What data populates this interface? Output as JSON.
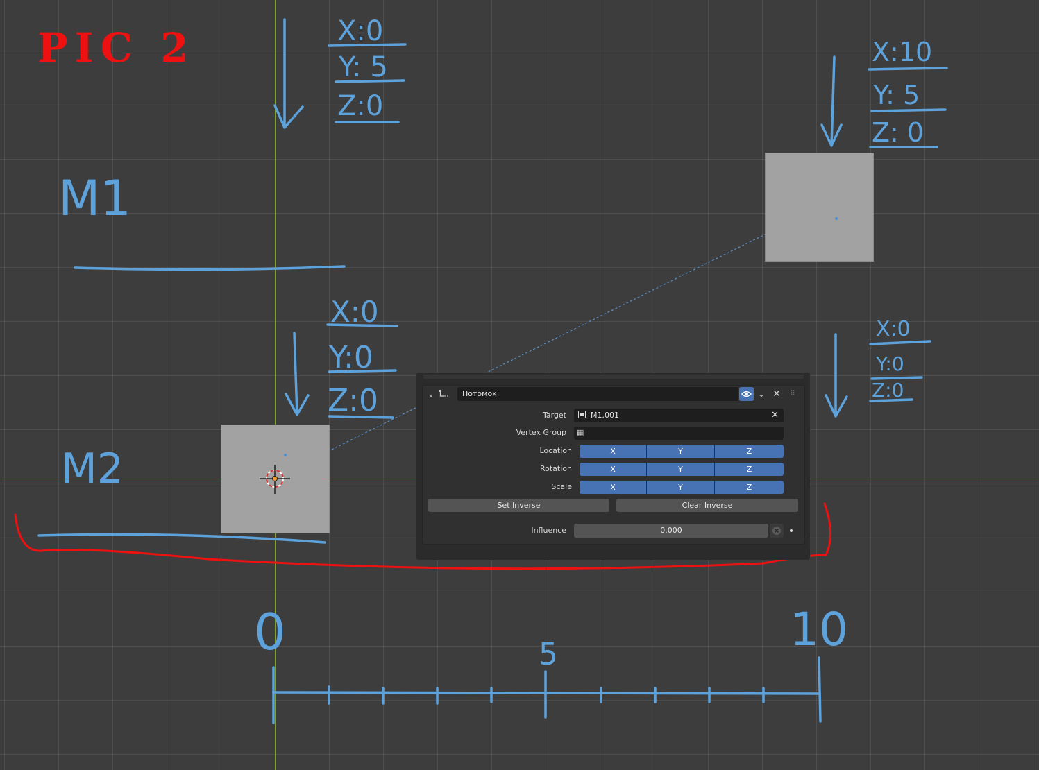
{
  "annotation": {
    "pic_title": "PIC 2",
    "m1_label": "M1",
    "m2_label": "M2",
    "m1_coords": {
      "x": "X:0",
      "y": "Y: 5",
      "z": "Z:0"
    },
    "m2_coords": {
      "x": "X:0",
      "y": "Y:0",
      "z": "Z:0"
    },
    "target_top_coords": {
      "x": "X:10",
      "y": "Y: 5",
      "z": "Z: 0"
    },
    "target_bottom_coords": {
      "x": "X:0",
      "y": "Y:0",
      "z": "Z:0"
    },
    "scale_labels": {
      "start": "0",
      "mid": "5",
      "end": "10"
    }
  },
  "constraint": {
    "name": "Потомок",
    "target_label": "Target",
    "target_value": "M1.001",
    "vertex_group_label": "Vertex Group",
    "vertex_group_value": "",
    "location_label": "Location",
    "rotation_label": "Rotation",
    "scale_label": "Scale",
    "axis_x": "X",
    "axis_y": "Y",
    "axis_z": "Z",
    "set_inverse_label": "Set Inverse",
    "clear_inverse_label": "Clear Inverse",
    "influence_label": "Influence",
    "influence_value": "0.000"
  },
  "colors": {
    "viewport_bg": "#3d3d3d",
    "annotation_blue": "#5ea2dc",
    "annotation_red": "#ee1111",
    "toggle_blue": "#4772b3",
    "y_axis_green": "#7da32a",
    "x_axis_red": "#a3353f",
    "cube_gray": "#a2a2a2"
  }
}
